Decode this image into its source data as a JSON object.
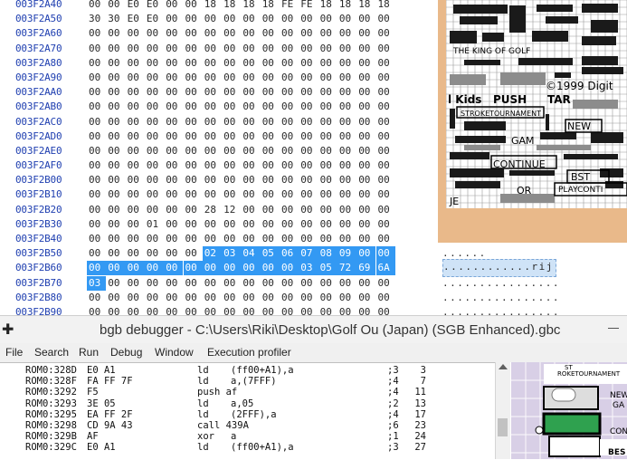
{
  "hex": {
    "rows": [
      {
        "addr": "003F2A40",
        "bytes": [
          "00",
          "00",
          "E0",
          "E0",
          "00",
          "00",
          "18",
          "18",
          "18",
          "18",
          "FE",
          "FE",
          "18",
          "18",
          "18",
          "18"
        ],
        "sel": []
      },
      {
        "addr": "003F2A50",
        "bytes": [
          "30",
          "30",
          "E0",
          "E0",
          "00",
          "00",
          "00",
          "00",
          "00",
          "00",
          "00",
          "00",
          "00",
          "00",
          "00",
          "00"
        ],
        "sel": []
      },
      {
        "addr": "003F2A60",
        "bytes": [
          "00",
          "00",
          "00",
          "00",
          "00",
          "00",
          "00",
          "00",
          "00",
          "00",
          "00",
          "00",
          "00",
          "00",
          "00",
          "00"
        ],
        "sel": []
      },
      {
        "addr": "003F2A70",
        "bytes": [
          "00",
          "00",
          "00",
          "00",
          "00",
          "00",
          "00",
          "00",
          "00",
          "00",
          "00",
          "00",
          "00",
          "00",
          "00",
          "00"
        ],
        "sel": []
      },
      {
        "addr": "003F2A80",
        "bytes": [
          "00",
          "00",
          "00",
          "00",
          "00",
          "00",
          "00",
          "00",
          "00",
          "00",
          "00",
          "00",
          "00",
          "00",
          "00",
          "00"
        ],
        "sel": []
      },
      {
        "addr": "003F2A90",
        "bytes": [
          "00",
          "00",
          "00",
          "00",
          "00",
          "00",
          "00",
          "00",
          "00",
          "00",
          "00",
          "00",
          "00",
          "00",
          "00",
          "00"
        ],
        "sel": []
      },
      {
        "addr": "003F2AA0",
        "bytes": [
          "00",
          "00",
          "00",
          "00",
          "00",
          "00",
          "00",
          "00",
          "00",
          "00",
          "00",
          "00",
          "00",
          "00",
          "00",
          "00"
        ],
        "sel": []
      },
      {
        "addr": "003F2AB0",
        "bytes": [
          "00",
          "00",
          "00",
          "00",
          "00",
          "00",
          "00",
          "00",
          "00",
          "00",
          "00",
          "00",
          "00",
          "00",
          "00",
          "00"
        ],
        "sel": []
      },
      {
        "addr": "003F2AC0",
        "bytes": [
          "00",
          "00",
          "00",
          "00",
          "00",
          "00",
          "00",
          "00",
          "00",
          "00",
          "00",
          "00",
          "00",
          "00",
          "00",
          "00"
        ],
        "sel": []
      },
      {
        "addr": "003F2AD0",
        "bytes": [
          "00",
          "00",
          "00",
          "00",
          "00",
          "00",
          "00",
          "00",
          "00",
          "00",
          "00",
          "00",
          "00",
          "00",
          "00",
          "00"
        ],
        "sel": []
      },
      {
        "addr": "003F2AE0",
        "bytes": [
          "00",
          "00",
          "00",
          "00",
          "00",
          "00",
          "00",
          "00",
          "00",
          "00",
          "00",
          "00",
          "00",
          "00",
          "00",
          "00"
        ],
        "sel": []
      },
      {
        "addr": "003F2AF0",
        "bytes": [
          "00",
          "00",
          "00",
          "00",
          "00",
          "00",
          "00",
          "00",
          "00",
          "00",
          "00",
          "00",
          "00",
          "00",
          "00",
          "00"
        ],
        "sel": []
      },
      {
        "addr": "003F2B00",
        "bytes": [
          "00",
          "00",
          "00",
          "00",
          "00",
          "00",
          "00",
          "00",
          "00",
          "00",
          "00",
          "00",
          "00",
          "00",
          "00",
          "00"
        ],
        "sel": []
      },
      {
        "addr": "003F2B10",
        "bytes": [
          "00",
          "00",
          "00",
          "00",
          "00",
          "00",
          "00",
          "00",
          "00",
          "00",
          "00",
          "00",
          "00",
          "00",
          "00",
          "00"
        ],
        "sel": []
      },
      {
        "addr": "003F2B20",
        "bytes": [
          "00",
          "00",
          "00",
          "00",
          "00",
          "00",
          "28",
          "12",
          "00",
          "00",
          "00",
          "00",
          "00",
          "00",
          "00",
          "00"
        ],
        "sel": []
      },
      {
        "addr": "003F2B30",
        "bytes": [
          "00",
          "00",
          "00",
          "01",
          "00",
          "00",
          "00",
          "00",
          "00",
          "00",
          "00",
          "00",
          "00",
          "00",
          "00",
          "00"
        ],
        "sel": []
      },
      {
        "addr": "003F2B40",
        "bytes": [
          "00",
          "00",
          "00",
          "00",
          "00",
          "00",
          "00",
          "00",
          "00",
          "00",
          "00",
          "00",
          "00",
          "00",
          "00",
          "00"
        ],
        "sel": []
      },
      {
        "addr": "003F2B50",
        "bytes": [
          "00",
          "00",
          "00",
          "00",
          "00",
          "00",
          "02",
          "03",
          "04",
          "05",
          "06",
          "07",
          "08",
          "09",
          "00",
          "00"
        ],
        "sel": [
          6,
          7,
          8,
          9,
          10,
          11,
          12,
          13,
          14,
          15
        ],
        "ascii": "......"
      },
      {
        "addr": "003F2B60",
        "bytes": [
          "00",
          "00",
          "00",
          "00",
          "00",
          "00",
          "00",
          "00",
          "00",
          "00",
          "00",
          "03",
          "05",
          "72",
          "69",
          "6A"
        ],
        "sel": [
          0,
          1,
          2,
          3,
          4,
          5,
          6,
          7,
          8,
          9,
          10,
          11,
          12,
          13,
          14,
          15
        ],
        "ascii": "............rij",
        "ascii_sel": true
      },
      {
        "addr": "003F2B70",
        "bytes": [
          "03",
          "00",
          "00",
          "00",
          "00",
          "00",
          "00",
          "00",
          "00",
          "00",
          "00",
          "00",
          "00",
          "00",
          "00",
          "00"
        ],
        "sel": [
          0
        ],
        "ascii": "................"
      },
      {
        "addr": "003F2B80",
        "bytes": [
          "00",
          "00",
          "00",
          "00",
          "00",
          "00",
          "00",
          "00",
          "00",
          "00",
          "00",
          "00",
          "00",
          "00",
          "00",
          "00"
        ],
        "sel": [],
        "ascii": "................"
      },
      {
        "addr": "003F2B90",
        "bytes": [
          "00",
          "00",
          "00",
          "00",
          "00",
          "00",
          "00",
          "00",
          "00",
          "00",
          "00",
          "00",
          "00",
          "00",
          "00",
          "00"
        ],
        "sel": [],
        "ascii": "................"
      }
    ]
  },
  "vram": {
    "texts": {
      "king": "THE KING OF GOLF",
      "copyright": "©1999 Digit",
      "kids": "l Kids",
      "push": "PUSH",
      "tar": "TAR",
      "stroke": "STROKETOURNAMENT",
      "new": "NEW",
      "gam": "GAM",
      "continue": "CONTINUE",
      "bst": "BST",
      "or": "OR",
      "playconti": "PLAYCONTI",
      "je": "JE"
    }
  },
  "debugger": {
    "title": "bgb debugger - C:\\Users\\Riki\\Desktop\\Golf Ou (Japan) (SGB Enhanced).gbc",
    "menu": [
      "File",
      "Search",
      "Run",
      "Debug",
      "Window",
      "Execution profiler"
    ],
    "disasm": [
      {
        "addr": "ROM0:328D",
        "bytes": "E0 A1",
        "mnem": "ld",
        "args": "(ff00+A1),a",
        "c1": ";3",
        "c2": "3"
      },
      {
        "addr": "ROM0:328F",
        "bytes": "FA FF 7F",
        "mnem": "ld",
        "args": "a,(7FFF)",
        "c1": ";4",
        "c2": "7"
      },
      {
        "addr": "ROM0:3292",
        "bytes": "F5",
        "mnem": "push af",
        "args": "",
        "c1": ";4",
        "c2": "11"
      },
      {
        "addr": "ROM0:3293",
        "bytes": "3E 05",
        "mnem": "ld",
        "args": "a,05",
        "c1": ";2",
        "c2": "13"
      },
      {
        "addr": "ROM0:3295",
        "bytes": "EA FF 2F",
        "mnem": "ld",
        "args": "(2FFF),a",
        "c1": ";4",
        "c2": "17"
      },
      {
        "addr": "ROM0:3298",
        "bytes": "CD 9A 43",
        "mnem": "call 439A",
        "args": "",
        "c1": ";6",
        "c2": "23"
      },
      {
        "addr": "ROM0:329B",
        "bytes": "AF",
        "mnem": "xor",
        "args": "a",
        "c1": ";1",
        "c2": "24"
      },
      {
        "addr": "ROM0:329C",
        "bytes": "E0 A1",
        "mnem": "ld",
        "args": "(ff00+A1),a",
        "c1": ";3",
        "c2": "27"
      }
    ],
    "sgb": {
      "st": "ST",
      "stroke": "ROKETOURNAMENT",
      "new": "NEW",
      "ga": "GA",
      "con": "CON",
      "bes": "BES"
    }
  }
}
